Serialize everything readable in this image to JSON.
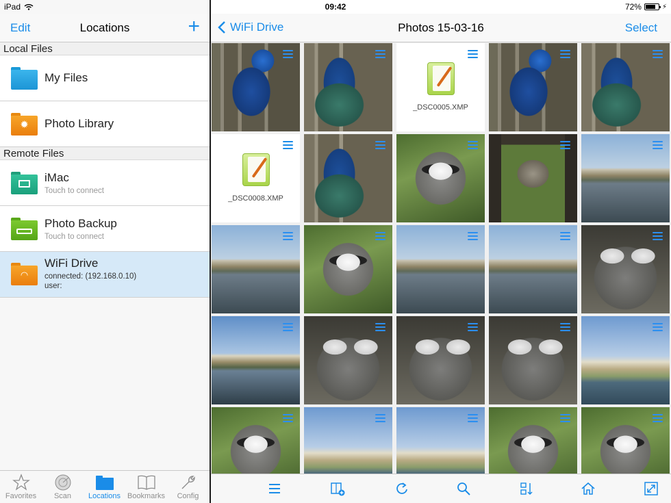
{
  "status": {
    "device": "iPad",
    "time": "09:42",
    "battery": "72%"
  },
  "left_nav": {
    "edit": "Edit",
    "title": "Locations",
    "add": "+"
  },
  "sections": {
    "local": "Local Files",
    "remote": "Remote Files"
  },
  "locations": {
    "my_files": {
      "title": "My Files"
    },
    "photo_library": {
      "title": "Photo Library"
    },
    "imac": {
      "title": "iMac",
      "sub": "Touch to connect"
    },
    "photo_backup": {
      "title": "Photo Backup",
      "sub": "Touch to connect"
    },
    "wifi_drive": {
      "title": "WiFi Drive",
      "sub1": "connected: (192.168.0.10)",
      "sub2": "user:"
    }
  },
  "tabs": [
    {
      "label": "Favorites",
      "icon": "star-icon"
    },
    {
      "label": "Scan",
      "icon": "radar-icon"
    },
    {
      "label": "Locations",
      "icon": "folder-icon"
    },
    {
      "label": "Bookmarks",
      "icon": "book-icon"
    },
    {
      "label": "Config",
      "icon": "wrench-icon"
    }
  ],
  "right_nav": {
    "back": "WiFi Drive",
    "title": "Photos 15-03-16",
    "select": "Select"
  },
  "files": {
    "xmp1": "_DSC0005.XMP",
    "xmp2": "_DSC0008.XMP"
  },
  "toolbar_icons": [
    "menu-icon",
    "new-folder-icon",
    "refresh-icon",
    "search-icon",
    "sort-icon",
    "home-icon",
    "expand-icon"
  ],
  "colors": {
    "accent": "#1a8ce8",
    "selected_row": "#d6e9f8"
  }
}
